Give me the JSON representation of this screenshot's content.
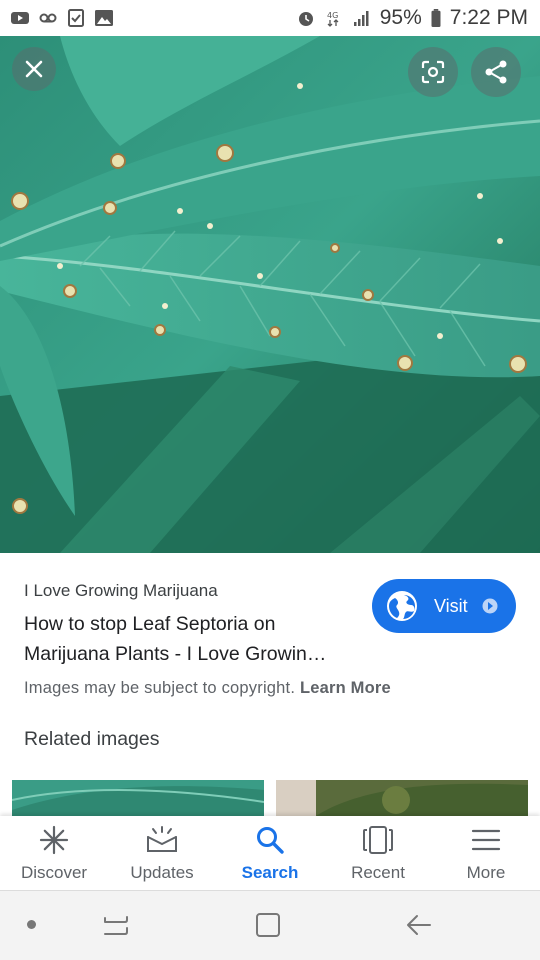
{
  "status_bar": {
    "battery": "95%",
    "time": "7:22 PM",
    "left_icons": [
      "youtube-icon",
      "voicemail-icon",
      "checklist-icon",
      "image-icon"
    ],
    "right_icons": [
      "alarm-icon",
      "data-4g-icon",
      "signal-icon",
      "battery-icon"
    ]
  },
  "viewer": {
    "buttons": [
      "close-icon",
      "lens-icon",
      "share-icon"
    ]
  },
  "result": {
    "source": "I Love Growing Marijuana",
    "title_line1": "How to stop Leaf Septoria on",
    "title_line2": "Marijuana Plants - I Love Growin…",
    "visit_label": "Visit",
    "copyright_text": "Images may be subject to copyright.",
    "learn_more": "Learn More",
    "related_heading": "Related images"
  },
  "bottom_nav": {
    "items": [
      {
        "label": "Discover",
        "icon": "asterisk-icon"
      },
      {
        "label": "Updates",
        "icon": "updates-icon"
      },
      {
        "label": "Search",
        "icon": "search-icon"
      },
      {
        "label": "Recent",
        "icon": "recent-icon"
      },
      {
        "label": "More",
        "icon": "menu-icon"
      }
    ],
    "active": "Search"
  },
  "colors": {
    "accent": "#1a73e8",
    "leaf": "#3a9c86",
    "text_secondary": "#5f6368"
  }
}
